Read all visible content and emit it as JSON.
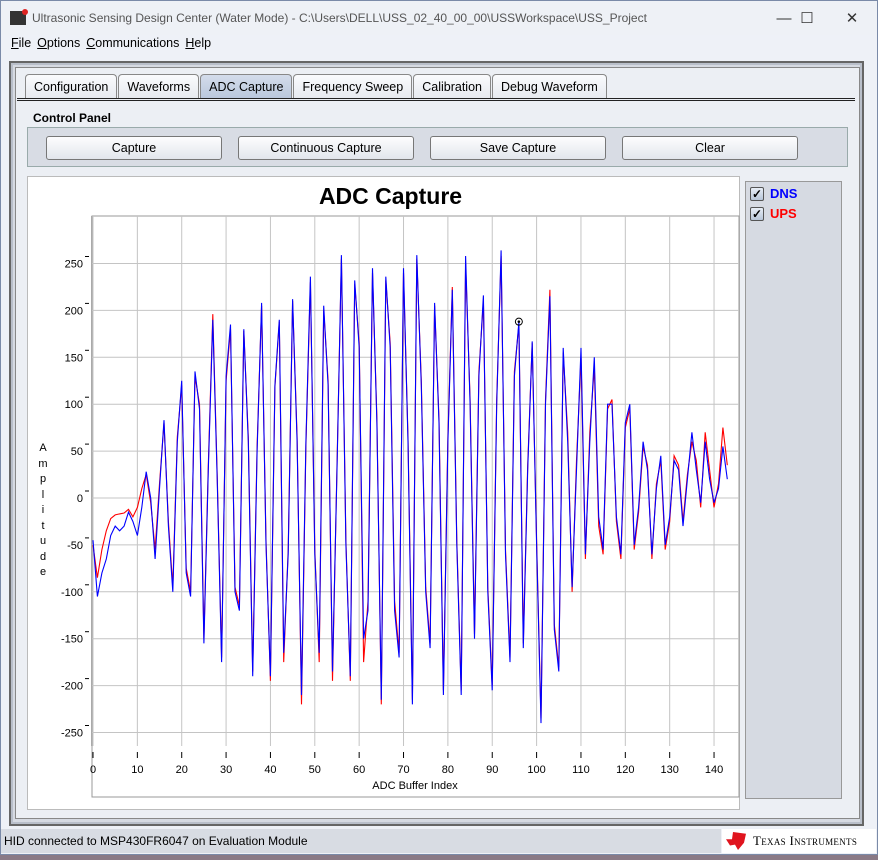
{
  "window": {
    "title": "Ultrasonic Sensing Design Center (Water Mode) - C:\\Users\\DELL\\USS_02_40_00_00\\USSWorkspace\\USS_Project",
    "minimize": "—",
    "maximize": "☐",
    "close": "✕"
  },
  "menu": [
    "File",
    "Options",
    "Communications",
    "Help"
  ],
  "tabs": [
    {
      "label": "Configuration"
    },
    {
      "label": "Waveforms"
    },
    {
      "label": "ADC Capture",
      "active": true
    },
    {
      "label": "Frequency Sweep"
    },
    {
      "label": "Calibration"
    },
    {
      "label": "Debug Waveform"
    }
  ],
  "control_panel": {
    "label": "Control Panel",
    "buttons": [
      "Capture",
      "Continuous Capture",
      "Save Capture",
      "Clear"
    ]
  },
  "legend": [
    {
      "label": "DNS",
      "checked": true,
      "color": "#0000ff"
    },
    {
      "label": "UPS",
      "checked": true,
      "color": "#ff0000"
    }
  ],
  "status": {
    "text": "HID connected to MSP430FR6047 on Evaluation Module",
    "brand": "Texas Instruments"
  },
  "chart_data": {
    "type": "line",
    "title": "ADC Capture",
    "xlabel": "ADC Buffer Index",
    "ylabel": "Amplitude",
    "xlim": [
      0,
      143
    ],
    "ylim": [
      -280,
      300
    ],
    "xticks": [
      0,
      10,
      20,
      30,
      40,
      50,
      60,
      70,
      80,
      90,
      100,
      110,
      120,
      130,
      140
    ],
    "yticks": [
      -250,
      -200,
      -150,
      -100,
      -50,
      0,
      50,
      100,
      150,
      200,
      250
    ],
    "grid": true,
    "legend_placement": "right",
    "series": [
      {
        "name": "DNS",
        "color": "#0000ff",
        "values": [
          -45,
          -105,
          -80,
          -65,
          -40,
          -30,
          -35,
          -30,
          -15,
          -25,
          -40,
          -10,
          28,
          0,
          -65,
          10,
          83,
          -30,
          -100,
          60,
          125,
          -80,
          -105,
          135,
          95,
          -155,
          30,
          190,
          20,
          -175,
          130,
          185,
          -100,
          -120,
          180,
          60,
          -190,
          50,
          208,
          -50,
          -190,
          120,
          190,
          -165,
          -60,
          212,
          60,
          -210,
          60,
          236,
          -60,
          -165,
          205,
          120,
          -185,
          30,
          259,
          -50,
          -190,
          232,
          160,
          -150,
          -120,
          245,
          80,
          -215,
          236,
          160,
          -120,
          -170,
          245,
          60,
          -220,
          259,
          120,
          -100,
          -160,
          208,
          80,
          -210,
          60,
          222,
          -50,
          -210,
          258,
          100,
          -150,
          130,
          216,
          -100,
          -205,
          100,
          264,
          -60,
          -175,
          130,
          188,
          -160,
          30,
          167,
          -50,
          -240,
          100,
          215,
          -140,
          -185,
          160,
          60,
          -95,
          30,
          160,
          -60,
          60,
          150,
          -20,
          -55,
          100,
          100,
          -20,
          -60,
          80,
          100,
          -50,
          -10,
          60,
          30,
          -60,
          10,
          45,
          -50,
          -20,
          40,
          30,
          -30,
          20,
          70,
          30,
          -5,
          60,
          20,
          -5,
          10,
          55,
          20
        ]
      },
      {
        "name": "UPS",
        "color": "#ff0000",
        "values": [
          -50,
          -85,
          -55,
          -35,
          -22,
          -18,
          -17,
          -16,
          -12,
          -20,
          -10,
          10,
          25,
          -5,
          -55,
          15,
          80,
          -25,
          -95,
          65,
          120,
          -75,
          -100,
          130,
          100,
          -150,
          35,
          196,
          25,
          -170,
          125,
          180,
          -95,
          -115,
          178,
          65,
          -185,
          55,
          205,
          -45,
          -195,
          118,
          188,
          -175,
          -55,
          210,
          65,
          -220,
          55,
          230,
          -55,
          -175,
          200,
          125,
          -195,
          35,
          255,
          -45,
          -195,
          228,
          165,
          -175,
          -110,
          240,
          85,
          -220,
          232,
          165,
          -110,
          -165,
          240,
          65,
          -215,
          255,
          125,
          -95,
          -155,
          205,
          85,
          -205,
          65,
          225,
          -45,
          -205,
          250,
          105,
          -145,
          135,
          210,
          -95,
          -200,
          105,
          258,
          -55,
          -170,
          135,
          185,
          -155,
          35,
          165,
          -45,
          -235,
          105,
          222,
          -135,
          -180,
          155,
          70,
          -100,
          40,
          150,
          -65,
          70,
          140,
          -30,
          -60,
          95,
          105,
          -25,
          -65,
          75,
          95,
          -55,
          -15,
          55,
          35,
          -65,
          15,
          40,
          -55,
          -25,
          45,
          35,
          -25,
          25,
          60,
          40,
          -10,
          70,
          30,
          -10,
          15,
          75,
          35
        ]
      }
    ],
    "marker": {
      "x": 96,
      "y": 188
    }
  }
}
